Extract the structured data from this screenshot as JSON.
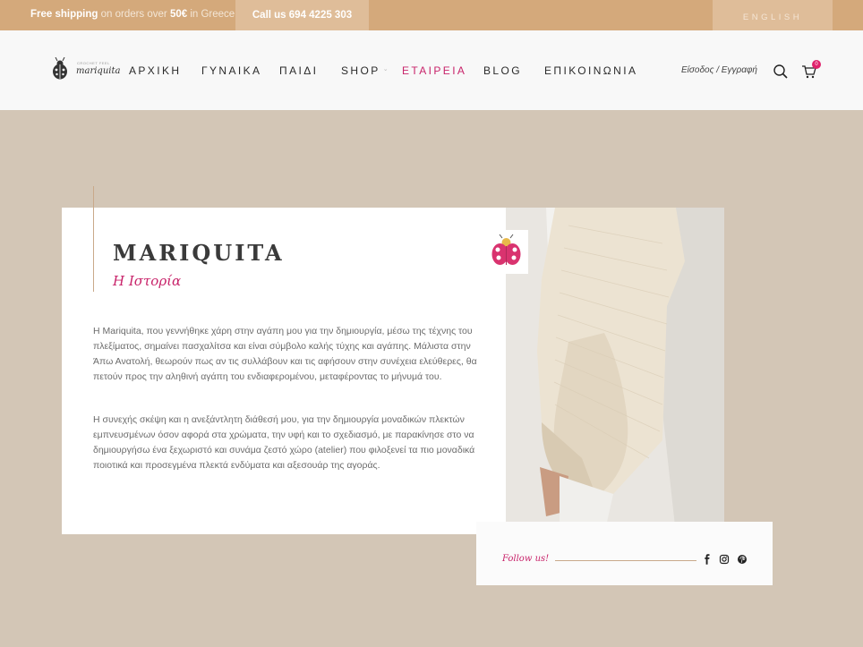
{
  "topbar": {
    "shipping_strong": "Free shipping",
    "shipping_text": " on orders over ",
    "shipping_amount": "50€",
    "shipping_tail": " in Greece.",
    "call": "Call us 694 4225 303",
    "language": "ENGLISH"
  },
  "brand": {
    "tagline": "CROCHET FEEL",
    "name": "mariquita"
  },
  "nav": {
    "items": [
      {
        "label": "ΑΡΧΙΚΗ"
      },
      {
        "label": "ΓΥΝΑΙΚΑ"
      },
      {
        "label": "ΠΑΙΔΙ"
      },
      {
        "label": "SHOP"
      },
      {
        "label": "ΕΤΑΙΡΕΙΑ"
      },
      {
        "label": "BLOG"
      },
      {
        "label": "ΕΠΙΚΟΙΝΩΝΙΑ"
      }
    ],
    "login": "Είσοδος / Εγγραφή",
    "cart_count": "0"
  },
  "story": {
    "title": "MARIQUITA",
    "subtitle": "Η Ιστορία",
    "paragraph1": "Η Mariquita, που γεννήθηκε χάρη στην αγάπη μου για την δημιουργία, μέσω της τέχνης του πλεξίματος, σημαίνει πασχαλίτσα και είναι σύμβολο καλής τύχης και αγάπης. Μάλιστα στην Άπω Ανατολή, θεωρούν πως αν τις συλλάβουν και τις αφήσουν στην συνέχεια ελεύθερες, θα πετούν προς την αληθινή αγάπη του ενδιαφερομένου, μεταφέροντας το μήνυμά του.",
    "paragraph2": "Η συνεχής σκέψη και η ανεξάντλητη διάθεσή μου, για την δημιουργία μοναδικών πλεκτών εμπνευσμένων όσον αφορά στα χρώματα, την υφή και το σχεδιασμό, με παρακίνησε στο να δημιουργήσω ένα ξεχωριστό και συνάμα ζεστό χώρο (atelier) που φιλοξενεί τα πιο μοναδικά ποιοτικά και προσεγμένα πλεκτά ενδύματα και αξεσουάρ της αγοράς."
  },
  "follow": {
    "label": "Follow us!",
    "icons": [
      "facebook-icon",
      "instagram-icon",
      "pinterest-icon"
    ]
  },
  "colors": {
    "topbar": "#d4a97b",
    "accent": "#c8236a",
    "background": "#d3c6b6"
  }
}
